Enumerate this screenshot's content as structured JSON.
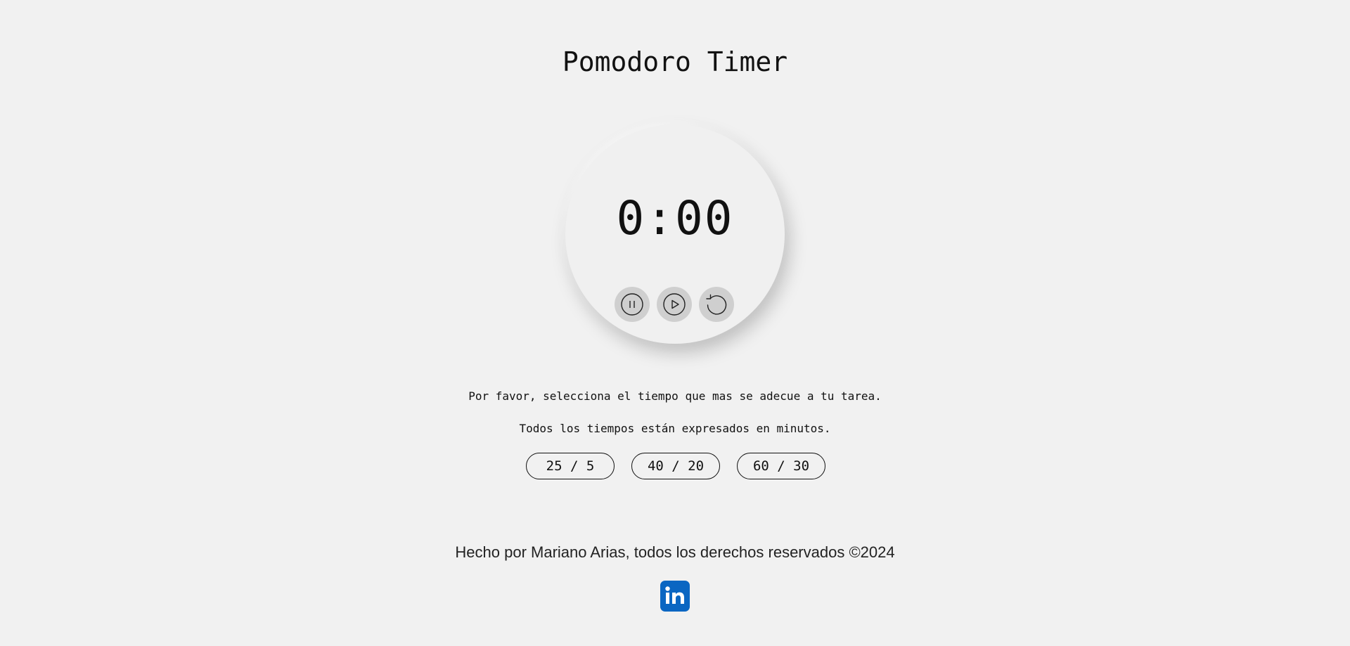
{
  "page": {
    "title": "Pomodoro Timer"
  },
  "timer": {
    "display": "0:00",
    "controls": [
      {
        "name": "pause",
        "icon": "pause-icon"
      },
      {
        "name": "play",
        "icon": "play-icon"
      },
      {
        "name": "reset",
        "icon": "reset-icon"
      }
    ]
  },
  "instructions": {
    "line1": "Por favor, selecciona el tiempo que mas se adecue a tu tarea.",
    "line2": "Todos los tiempos están expresados en minutos."
  },
  "presets": [
    {
      "label": "25 / 5"
    },
    {
      "label": "40 / 20"
    },
    {
      "label": "60 / 30"
    }
  ],
  "footer": {
    "text": "Hecho por Mariano Arias, todos los derechos reservados ©2024",
    "social_icon": "linkedin-icon",
    "social_label": "in"
  },
  "colors": {
    "background": "#f1f1f1",
    "control_button": "#cfcfcf",
    "linkedin_blue": "#0a66c2"
  }
}
